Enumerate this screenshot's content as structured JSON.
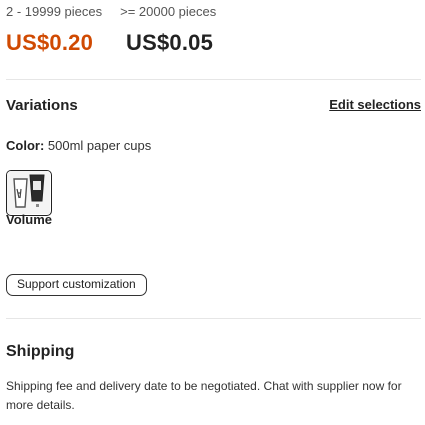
{
  "price_tiers": [
    {
      "qty": "2 - 19999 pieces",
      "price": "US$0.20"
    },
    {
      "qty": ">= 20000 pieces",
      "price": "US$0.05"
    }
  ],
  "variations": {
    "title": "Variations",
    "edit_label": "Edit selections",
    "color_label": "Color:",
    "color_value": "500ml paper cups",
    "swatch_icon": "paper-cup-thumbnail",
    "volume_label": "Volume",
    "volume_option": "Support customization"
  },
  "shipping": {
    "title": "Shipping",
    "text": "Shipping fee and delivery date to be negotiated. Chat with supplier now for more details."
  },
  "colors": {
    "price_accent": "#d04a02",
    "text": "#222222",
    "divider": "#e6e6e6"
  }
}
